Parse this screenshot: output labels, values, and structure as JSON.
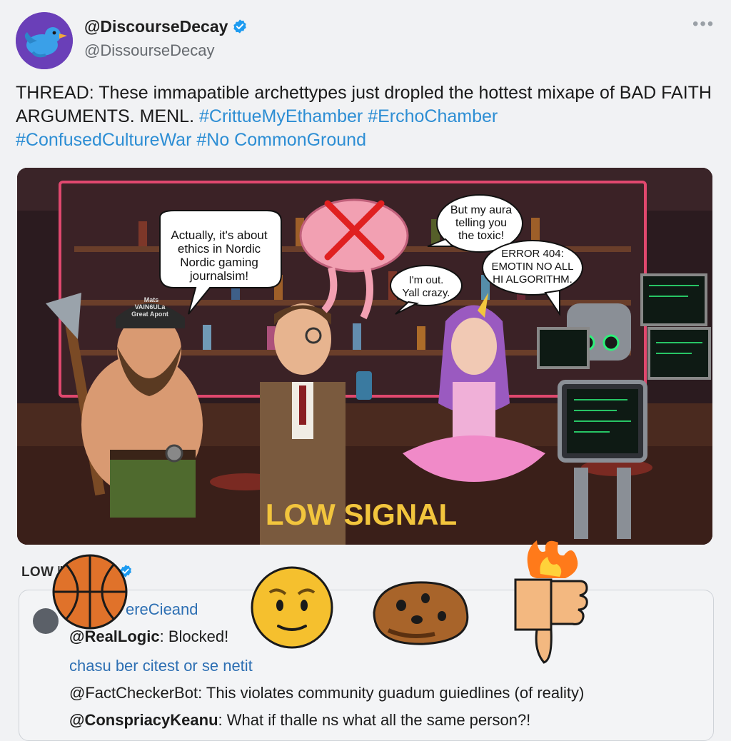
{
  "author": {
    "display_name": "@DiscourseDecay",
    "handle": "@DissourseDecay",
    "avatar_icon": "bird-icon",
    "verified_icon": "verified-badge-icon"
  },
  "more_label": "•••",
  "tweet": {
    "text_start": "THREAD: These immapatible archettypes just dropled the hottest mixape of BAD FAITH ARGUMENTS. MENL. ",
    "hashtags": [
      "#CrittueMyEthamber",
      "#ErchoChamber",
      "#ConfusedCultureWar",
      "#No CommonGround"
    ]
  },
  "image": {
    "bubble_barbarian": [
      "Actually, it's about",
      "ethics in Nordic",
      "Nordic gaming",
      "journalsim!"
    ],
    "hat_text": [
      "Mats",
      "VAIN6ULa",
      "Great Apont"
    ],
    "bubble_gentleman": [
      "I'm out.",
      "Yall crazy."
    ],
    "bubble_unicorn": [
      "But my aura",
      "telling you",
      "the toxic!"
    ],
    "bubble_robot": [
      "ERROR 404:",
      "EMOTIN NO ALL",
      "HI ALGORITHM."
    ],
    "caption": "LOW SIGNAL"
  },
  "section": {
    "title": "LOW ᴵᴺ   ᴵEALS",
    "sub_handle": "ereCieand",
    "replies": [
      {
        "user": "@RealLogic",
        "text": ": Blocked!"
      },
      {
        "user": "",
        "text": "chasu ber citest or se netit"
      },
      {
        "user": "@FactCheckerBot",
        "text": ": This violates community guadum guiedlines (of reality)"
      },
      {
        "user": "@ConspriacyKeanu",
        "text": ": What if thalle ns what all the same person?!"
      }
    ]
  },
  "reactions": [
    "basketball-icon",
    "worried-face-icon",
    "burnt-cookie-icon",
    "flaming-thumbs-down-icon"
  ],
  "colors": {
    "link": "#2d8ed4",
    "verified": "#1d9bf0",
    "avatar_bg": "#6a3fb8",
    "caption": "#f2c53d"
  }
}
